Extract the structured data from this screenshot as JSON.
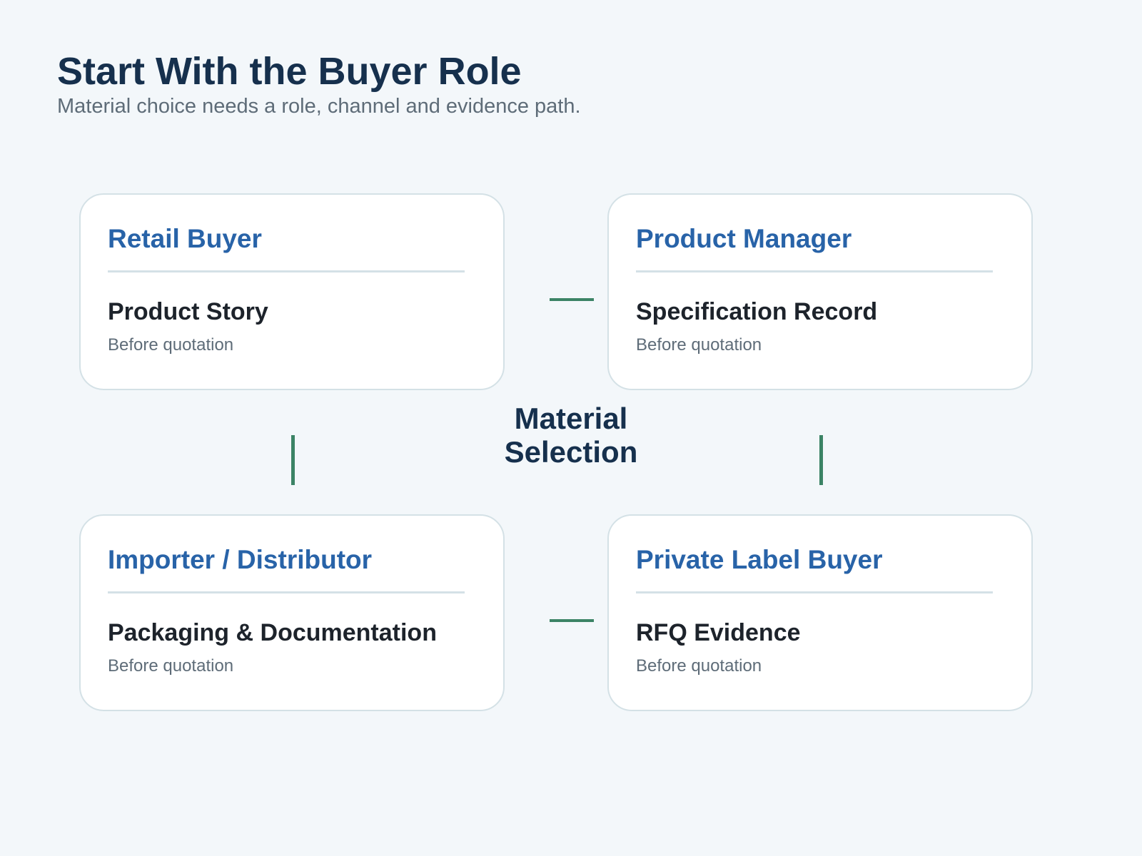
{
  "header": {
    "title": "Start With the Buyer Role",
    "subtitle": "Material choice needs a role, channel and evidence path."
  },
  "center": {
    "line1": "Material",
    "line2": "Selection"
  },
  "cards": [
    {
      "role": "Retail Buyer",
      "focus": "Product Story",
      "timing": "Before quotation"
    },
    {
      "role": "Product Manager",
      "focus": "Specification Record",
      "timing": "Before quotation"
    },
    {
      "role": "Importer / Distributor",
      "focus": "Packaging & Documentation",
      "timing": "Before quotation"
    },
    {
      "role": "Private Label Buyer",
      "focus": "RFQ Evidence",
      "timing": "Before quotation"
    }
  ],
  "colors": {
    "background": "#f3f7fa",
    "title": "#16304d",
    "role_heading": "#2863a8",
    "connector": "#3b8365",
    "card_border": "#d4e1e6"
  }
}
